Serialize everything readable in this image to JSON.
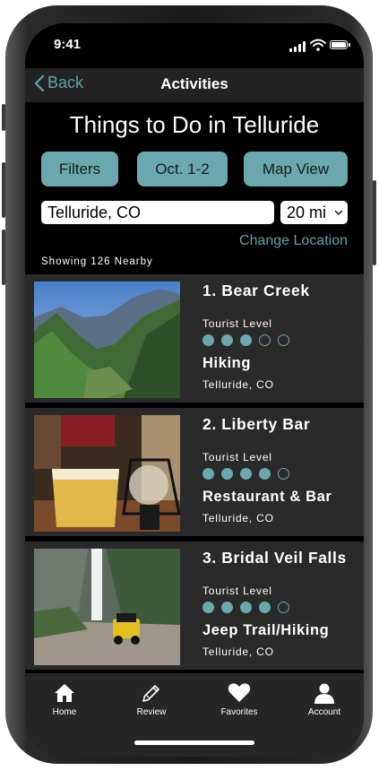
{
  "status": {
    "time": "9:41"
  },
  "nav": {
    "back_label": "Back",
    "title": "Activities"
  },
  "heading": "Things to Do in Telluride",
  "buttons": {
    "filters": "Filters",
    "dates": "Oct. 1-2",
    "map": "Map View"
  },
  "location": {
    "value": "Telluride, CO",
    "distance": "20 mi",
    "change_label": "Change Location"
  },
  "showing": "Showing 126 Nearby",
  "level_label": "Tourist Level",
  "colors": {
    "accent": "#6aa8ad",
    "link": "#5fa3ab",
    "card": "#2a2a2a"
  },
  "activities": [
    {
      "title": "1. Bear Creek",
      "level_text": "Tourist Level",
      "level": 3,
      "category": "Hiking",
      "place": "Telluride, CO"
    },
    {
      "title": "2. Liberty Bar",
      "level_text": "Tourist Level",
      "level": 4,
      "category": "Restaurant & Bar",
      "place": "Telluride, CO"
    },
    {
      "title": "3. Bridal Veil Falls",
      "level_text": "Tourist Level",
      "level": 4,
      "category": "Jeep Trail/Hiking",
      "place": "Telluride, CO"
    }
  ],
  "tabs": [
    {
      "label": "Home",
      "icon": "home-icon"
    },
    {
      "label": "Review",
      "icon": "pencil-icon"
    },
    {
      "label": "Favorites",
      "icon": "heart-icon"
    },
    {
      "label": "Account",
      "icon": "person-icon"
    }
  ]
}
